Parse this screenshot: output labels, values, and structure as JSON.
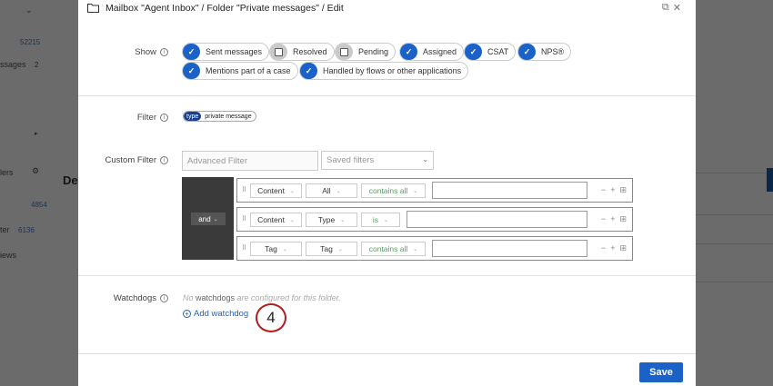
{
  "background": {
    "left_items": [
      {
        "label": "ssages",
        "count": "2"
      },
      {
        "label": "lers"
      },
      {
        "label": "ter"
      },
      {
        "label": "iews"
      }
    ],
    "left_counts": [
      "52215",
      "4854",
      "6136"
    ],
    "peek_title": "De"
  },
  "modal": {
    "title": "Mailbox \"Agent Inbox\" / Folder \"Private messages\" / Edit",
    "show": {
      "label": "Show",
      "options": [
        {
          "label": "Sent messages",
          "checked": true
        },
        {
          "label": "Resolved",
          "checked": false
        },
        {
          "label": "Pending",
          "checked": false
        },
        {
          "label": "Assigned",
          "checked": true
        },
        {
          "label": "CSAT",
          "checked": true
        },
        {
          "label": "NPS®",
          "checked": true
        },
        {
          "label": "Mentions part of a case",
          "checked": true
        },
        {
          "label": "Handled by flows or other applications",
          "checked": true
        }
      ]
    },
    "filter": {
      "label": "Filter",
      "tag_type": "type",
      "tag_value": "private message"
    },
    "custom_filter": {
      "label": "Custom Filter",
      "advanced_placeholder": "Advanced Filter",
      "saved_filters": "Saved filters",
      "operator": "and",
      "conditions": [
        {
          "field": "Content",
          "scope": "All",
          "op": "contains all"
        },
        {
          "field": "Content",
          "scope": "Type",
          "op": "is"
        },
        {
          "field": "Tag",
          "scope": "Tag",
          "op": "contains all"
        }
      ]
    },
    "watchdogs": {
      "label": "Watchdogs",
      "empty_prefix": "No ",
      "empty_word": "watchdogs",
      "empty_suffix": " are configured for this folder.",
      "add_label": "Add watchdog"
    },
    "step_number": "4",
    "save_label": "Save"
  },
  "colors": {
    "accent": "#1a62c8",
    "step_ring": "#b01d1d"
  }
}
